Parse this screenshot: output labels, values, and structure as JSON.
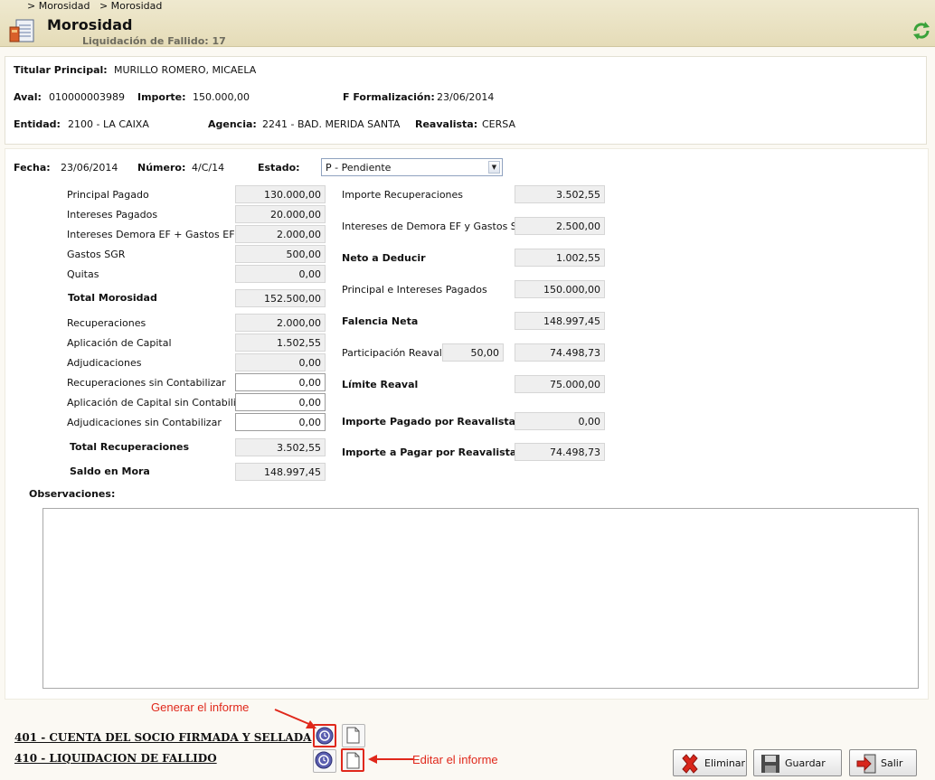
{
  "breadcrumb": [
    "> Morosidad",
    "> Morosidad"
  ],
  "header": {
    "title": "Morosidad",
    "subtitle": "Liquidación de Fallido: 17"
  },
  "info": {
    "titular_label": "Titular Principal:",
    "titular": "MURILLO ROMERO, MICAELA",
    "aval_label": "Aval:",
    "aval": "010000003989",
    "importe_label": "Importe:",
    "importe": "150.000,00",
    "fform_label": "F Formalización:",
    "fform": "23/06/2014",
    "entidad_label": "Entidad:",
    "entidad": "2100 - LA CAIXA",
    "agencia_label": "Agencia:",
    "agencia": "2241 - BAD. MERIDA SANTA",
    "reavalista_label": "Reavalista:",
    "reavalista": "CERSA"
  },
  "form": {
    "fecha_label": "Fecha:",
    "fecha": "23/06/2014",
    "numero_label": "Número:",
    "numero": "4/C/14",
    "estado_label": "Estado:",
    "estado": "P - Pendiente"
  },
  "left_fields": [
    {
      "label": "Principal Pagado",
      "value": "130.000,00"
    },
    {
      "label": "Intereses Pagados",
      "value": "20.000,00"
    },
    {
      "label": "Intereses Demora EF + Gastos EF",
      "value": "2.000,00"
    },
    {
      "label": "Gastos SGR",
      "value": "500,00"
    },
    {
      "label": "Quitas",
      "value": "0,00"
    },
    {
      "label": "Total Morosidad",
      "value": "152.500,00"
    },
    {
      "label": "Recuperaciones",
      "value": "2.000,00"
    },
    {
      "label": "Aplicación de Capital",
      "value": "1.502,55"
    },
    {
      "label": "Adjudicaciones",
      "value": "0,00"
    },
    {
      "label": "Recuperaciones sin Contabilizar",
      "value": "0,00"
    },
    {
      "label": "Aplicación de Capital sin Contabilizar",
      "value": "0,00"
    },
    {
      "label": "Adjudicaciones sin Contabilizar",
      "value": "0,00"
    },
    {
      "label": "Total Recuperaciones",
      "value": "3.502,55"
    },
    {
      "label": "Saldo en Mora",
      "value": "148.997,45"
    }
  ],
  "right_fields": [
    {
      "label": "Importe Recuperaciones",
      "value": "3.502,55"
    },
    {
      "label": "Intereses de Demora EF y Gastos SGR",
      "value": "2.500,00"
    },
    {
      "label": "Neto a Deducir",
      "value": "1.002,55"
    },
    {
      "label": "Principal e Intereses Pagados",
      "value": "150.000,00"
    },
    {
      "label": "Falencia Neta",
      "value": "148.997,45"
    },
    {
      "label": "Participación Reaval",
      "value": "74.498,73",
      "pct": "50,00"
    },
    {
      "label": "Límite Reaval",
      "value": "75.000,00"
    },
    {
      "label": "Importe Pagado por Reavalista",
      "value": "0,00"
    },
    {
      "label": "Importe a Pagar por Reavalista",
      "value": "74.498,73"
    }
  ],
  "observaciones_label": "Observaciones:",
  "observaciones": "",
  "reports": [
    {
      "label": "401 - CUENTA DEL SOCIO FIRMADA Y SELLADA"
    },
    {
      "label": "410 - LIQUIDACION DE FALLIDO"
    }
  ],
  "annotations": {
    "generar": "Generar el informe",
    "editar": "Editar el informe"
  },
  "buttons": {
    "eliminar": "Eliminar",
    "guardar": "Guardar",
    "salir": "Salir"
  },
  "colors": {
    "header_bg": "#e8e0c0",
    "annotation": "#e0281b",
    "readonly_field": "#efefef"
  }
}
